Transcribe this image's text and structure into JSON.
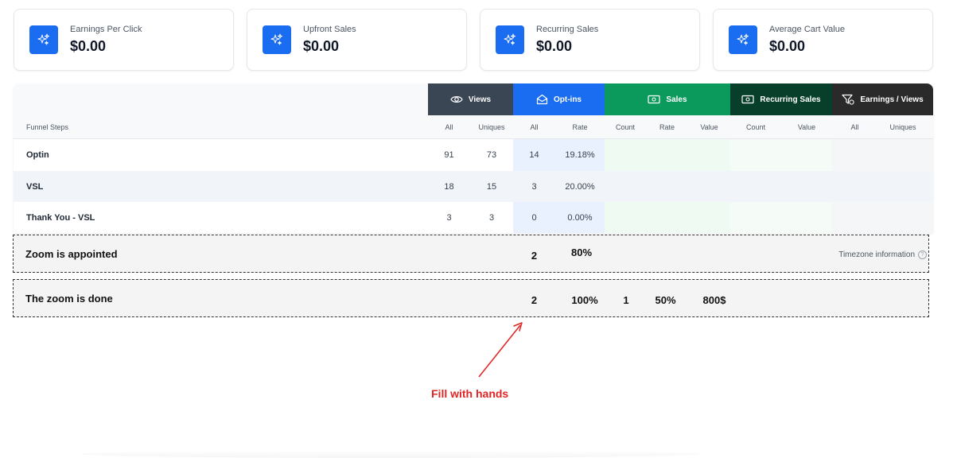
{
  "cards": [
    {
      "label": "Earnings Per Click",
      "value": "$0.00",
      "icon": "sparkles-icon"
    },
    {
      "label": "Upfront Sales",
      "value": "$0.00",
      "icon": "sparkles-icon"
    },
    {
      "label": "Recurring Sales",
      "value": "$0.00",
      "icon": "sparkles-icon"
    },
    {
      "label": "Average Cart Value",
      "value": "$0.00",
      "icon": "sparkles-icon"
    }
  ],
  "groups": [
    {
      "label": "Views",
      "icon": "eye-icon",
      "color": "#3b4654"
    },
    {
      "label": "Opt-ins",
      "icon": "envelope-open-icon",
      "color": "#1a6cf0"
    },
    {
      "label": "Sales",
      "icon": "banknote-icon",
      "color": "#0b9a5c"
    },
    {
      "label": "Recurring Sales",
      "icon": "banknote-icon",
      "color": "#073f2a"
    },
    {
      "label": "Earnings / Views",
      "icon": "filter-dollar-icon",
      "color": "#2a2a2a"
    }
  ],
  "subheaders": {
    "funnel_steps": "Funnel Steps",
    "views_all": "All",
    "views_uniques": "Uniques",
    "optins_all": "All",
    "optins_rate": "Rate",
    "sales_count": "Count",
    "sales_rate": "Rate",
    "sales_value": "Value",
    "recurring_count": "Count",
    "recurring_value": "Value",
    "earnings_all": "All",
    "earnings_uniques": "Uniques"
  },
  "rows": [
    {
      "name": "Optin",
      "views_all": "91",
      "views_uniques": "73",
      "optins_all": "14",
      "optins_rate": "19.18%"
    },
    {
      "name": "VSL",
      "views_all": "18",
      "views_uniques": "15",
      "optins_all": "3",
      "optins_rate": "20.00%"
    },
    {
      "name": "Thank You - VSL",
      "views_all": "3",
      "views_uniques": "3",
      "optins_all": "0",
      "optins_rate": "0.00%"
    }
  ],
  "manual_rows": [
    {
      "name": "Zoom is appointed",
      "optins_all": "2",
      "optins_rate": "80%",
      "timezone": "Timezone information"
    },
    {
      "name": "The zoom is done",
      "optins_all": "2",
      "optins_rate": "100%",
      "sales_count": "1",
      "sales_rate": "50%",
      "sales_value": "800$"
    }
  ],
  "annotation": "Fill with hands",
  "colors": {
    "accent": "#1a6cf0",
    "annotation": "#e02424"
  }
}
